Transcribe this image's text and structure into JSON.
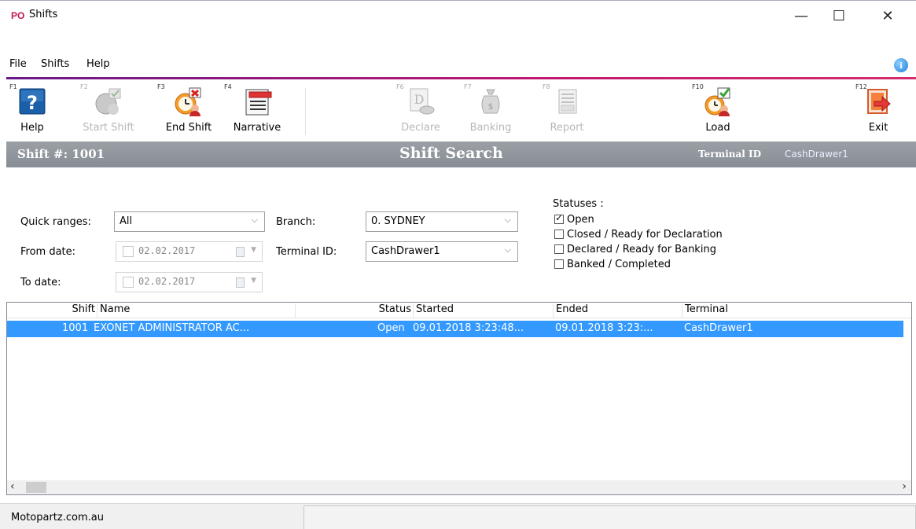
{
  "window": {
    "logo": "PO",
    "title": "Shifts",
    "minimize_glyph": "—",
    "maximize_glyph": "☐",
    "close_glyph": "✕"
  },
  "menu": {
    "items": [
      "File",
      "Shifts",
      "Help"
    ],
    "info_icon": "i"
  },
  "toolbar": {
    "buttons": [
      {
        "fkey": "F1",
        "label": "Help",
        "icon": "help-icon",
        "enabled": true
      },
      {
        "fkey": "F2",
        "label": "Start Shift",
        "icon": "start-shift-icon",
        "enabled": false
      },
      {
        "fkey": "F3",
        "label": "End Shift",
        "icon": "end-shift-icon",
        "enabled": true
      },
      {
        "fkey": "F4",
        "label": "Narrative",
        "icon": "narrative-icon",
        "enabled": true
      },
      {
        "fkey": "F6",
        "label": "Declare",
        "icon": "declare-icon",
        "enabled": false
      },
      {
        "fkey": "F7",
        "label": "Banking",
        "icon": "banking-icon",
        "enabled": false
      },
      {
        "fkey": "F8",
        "label": "Report",
        "icon": "report-icon",
        "enabled": false
      },
      {
        "fkey": "F10",
        "label": "Load",
        "icon": "load-icon",
        "enabled": true
      },
      {
        "fkey": "F12",
        "label": "Exit",
        "icon": "exit-icon",
        "enabled": true
      }
    ]
  },
  "header": {
    "shift_number": "Shift #: 1001",
    "page_title": "Shift Search",
    "terminal_label": "Terminal ID",
    "terminal_value": "CashDrawer1"
  },
  "filters": {
    "quick_ranges_label": "Quick ranges:",
    "quick_ranges_value": "All",
    "from_date_label": "From date:",
    "from_date_value": "02.02.2017",
    "to_date_label": "To date:",
    "to_date_value": "02.02.2017",
    "branch_label": "Branch:",
    "branch_value": "0. SYDNEY",
    "terminal_label": "Terminal ID:",
    "terminal_value": "CashDrawer1",
    "statuses_label": "Statuses :",
    "statuses": [
      {
        "label": "Open",
        "checked": true
      },
      {
        "label": "Closed / Ready for Declaration",
        "checked": false
      },
      {
        "label": "Declared / Ready for Banking",
        "checked": false
      },
      {
        "label": "Banked / Completed",
        "checked": false
      }
    ]
  },
  "grid": {
    "columns": [
      "Shift",
      "Name",
      "Status",
      "Started",
      "Ended",
      "Terminal"
    ],
    "rows": [
      {
        "shift": "1001",
        "name": "EXONET ADMINISTRATOR AC...",
        "status": "Open",
        "started": "09.01.2018 3:23:48...",
        "ended": "09.01.2018 3:23:...",
        "terminal": "CashDrawer1",
        "selected": true
      }
    ]
  },
  "statusbar": {
    "text": "Motopartz.com.au"
  },
  "colors": {
    "selection": "#3399ff",
    "header_band": "#8f959b",
    "accent_line": "#c2186f",
    "logo": "#c21848"
  }
}
